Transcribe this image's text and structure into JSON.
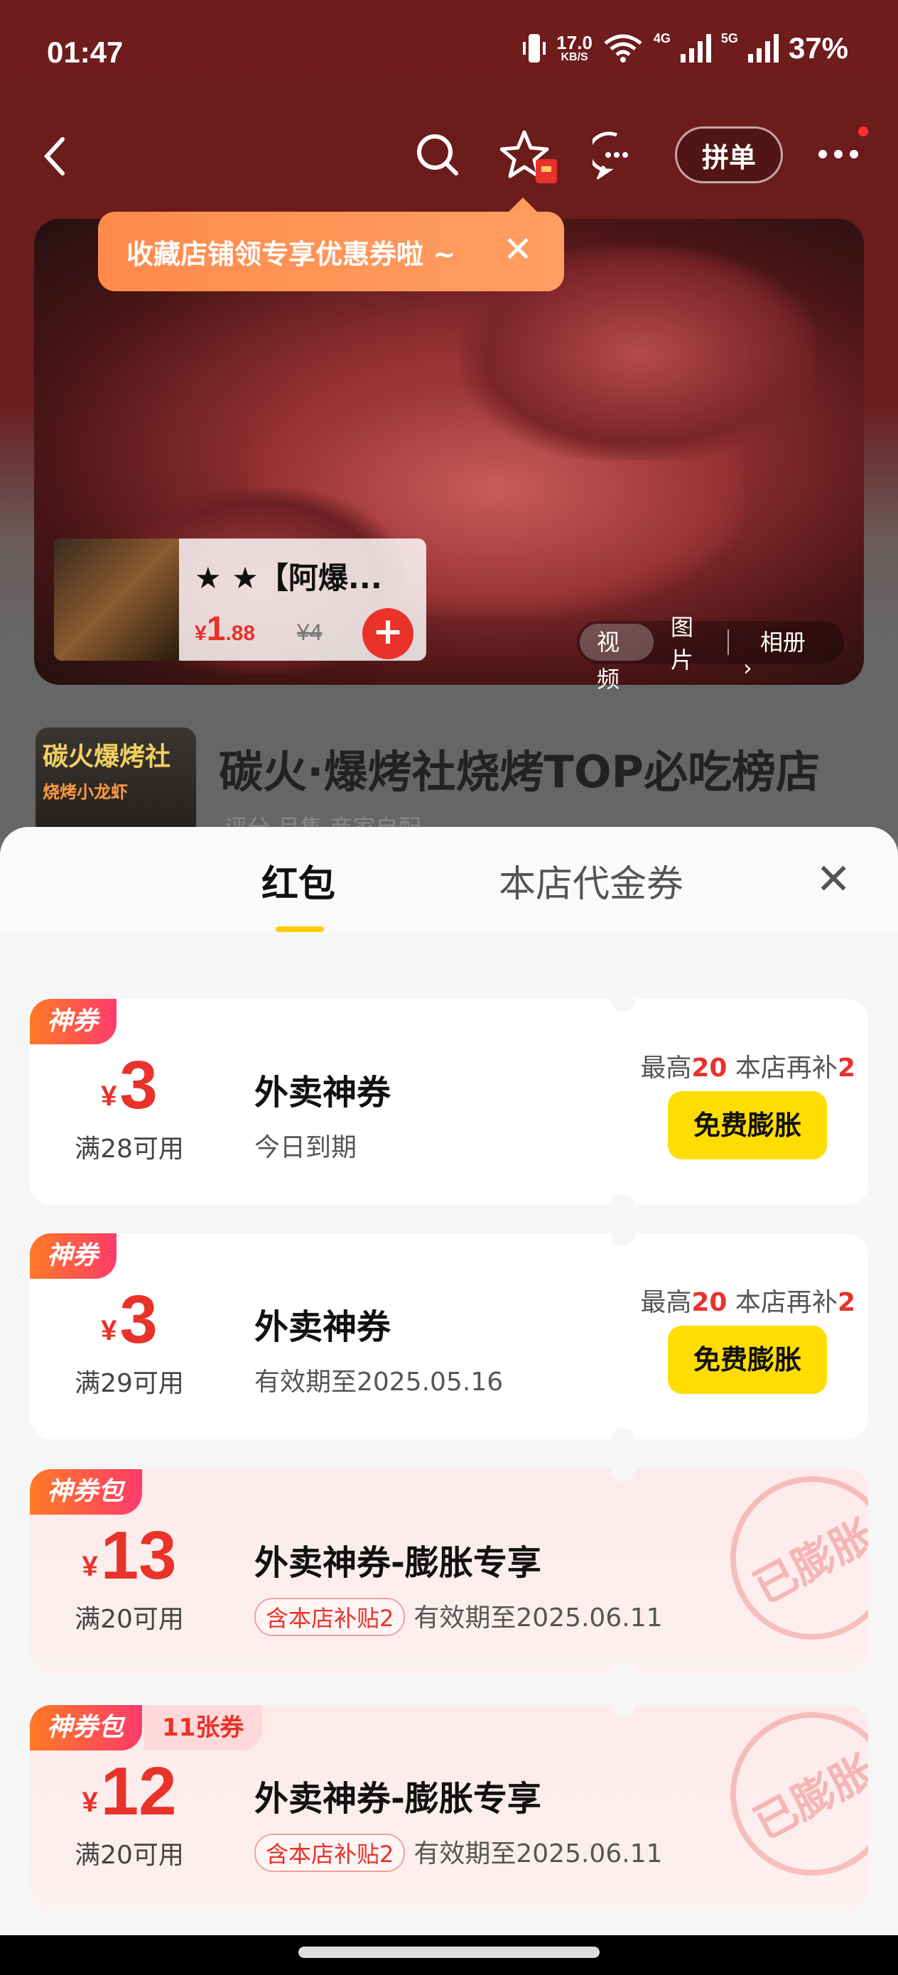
{
  "status": {
    "time": "01:47",
    "speed": "17.0",
    "speed_unit": "KB/S",
    "net1": "4G",
    "net2": "5G",
    "battery": "37%"
  },
  "nav": {
    "back": "back-icon",
    "search": "search-icon",
    "favorite": "star-icon",
    "chat": "chat-icon",
    "group_order": "拼单",
    "more": "more-icon"
  },
  "tooltip": {
    "text": "收藏店铺领专享优惠券啦 ~",
    "close": "✕"
  },
  "product": {
    "name": "★ ★【阿爆...",
    "currency": "¥",
    "price_int": "1",
    "price_dec": ".88",
    "old_price": "¥4",
    "add": "+"
  },
  "media_tabs": [
    "视频",
    "图片",
    "相册"
  ],
  "store": {
    "name": "碳火·爆烤社烧烤TOP必吃榜店",
    "logo_text": "碳火爆烤社",
    "logo_sub": "烧烤小龙虾",
    "meta": "评分    月售       商家自配"
  },
  "sheet": {
    "tabs": [
      "红包",
      "本店代金券"
    ],
    "close": "✕"
  },
  "coupons": [
    {
      "badge": "神券",
      "currency": "¥",
      "amount": "3",
      "condition": "满28可用",
      "title": "外卖神券",
      "desc": "今日到期",
      "max_label": "最高",
      "max_val": "20",
      "sub_label": " 本店再补",
      "sub_val": "2",
      "button": "免费膨胀"
    },
    {
      "badge": "神券",
      "currency": "¥",
      "amount": "3",
      "condition": "满29可用",
      "title": "外卖神券",
      "desc": "有效期至2025.05.16",
      "max_label": "最高",
      "max_val": "20",
      "sub_label": " 本店再补",
      "sub_val": "2",
      "button": "免费膨胀"
    },
    {
      "badge": "神券包",
      "currency": "¥",
      "amount": "13",
      "condition": "满20可用",
      "title": "外卖神券-膨胀专享",
      "tag": "含本店补贴2",
      "desc": "有效期至2025.06.11",
      "stamp": "已膨胀"
    },
    {
      "badge": "神券包",
      "badge2": "11张券",
      "currency": "¥",
      "amount": "12",
      "condition": "满20可用",
      "title": "外卖神券-膨胀专享",
      "tag": "含本店补贴2",
      "desc": "有效期至2025.06.11",
      "stamp": "已膨胀"
    }
  ]
}
